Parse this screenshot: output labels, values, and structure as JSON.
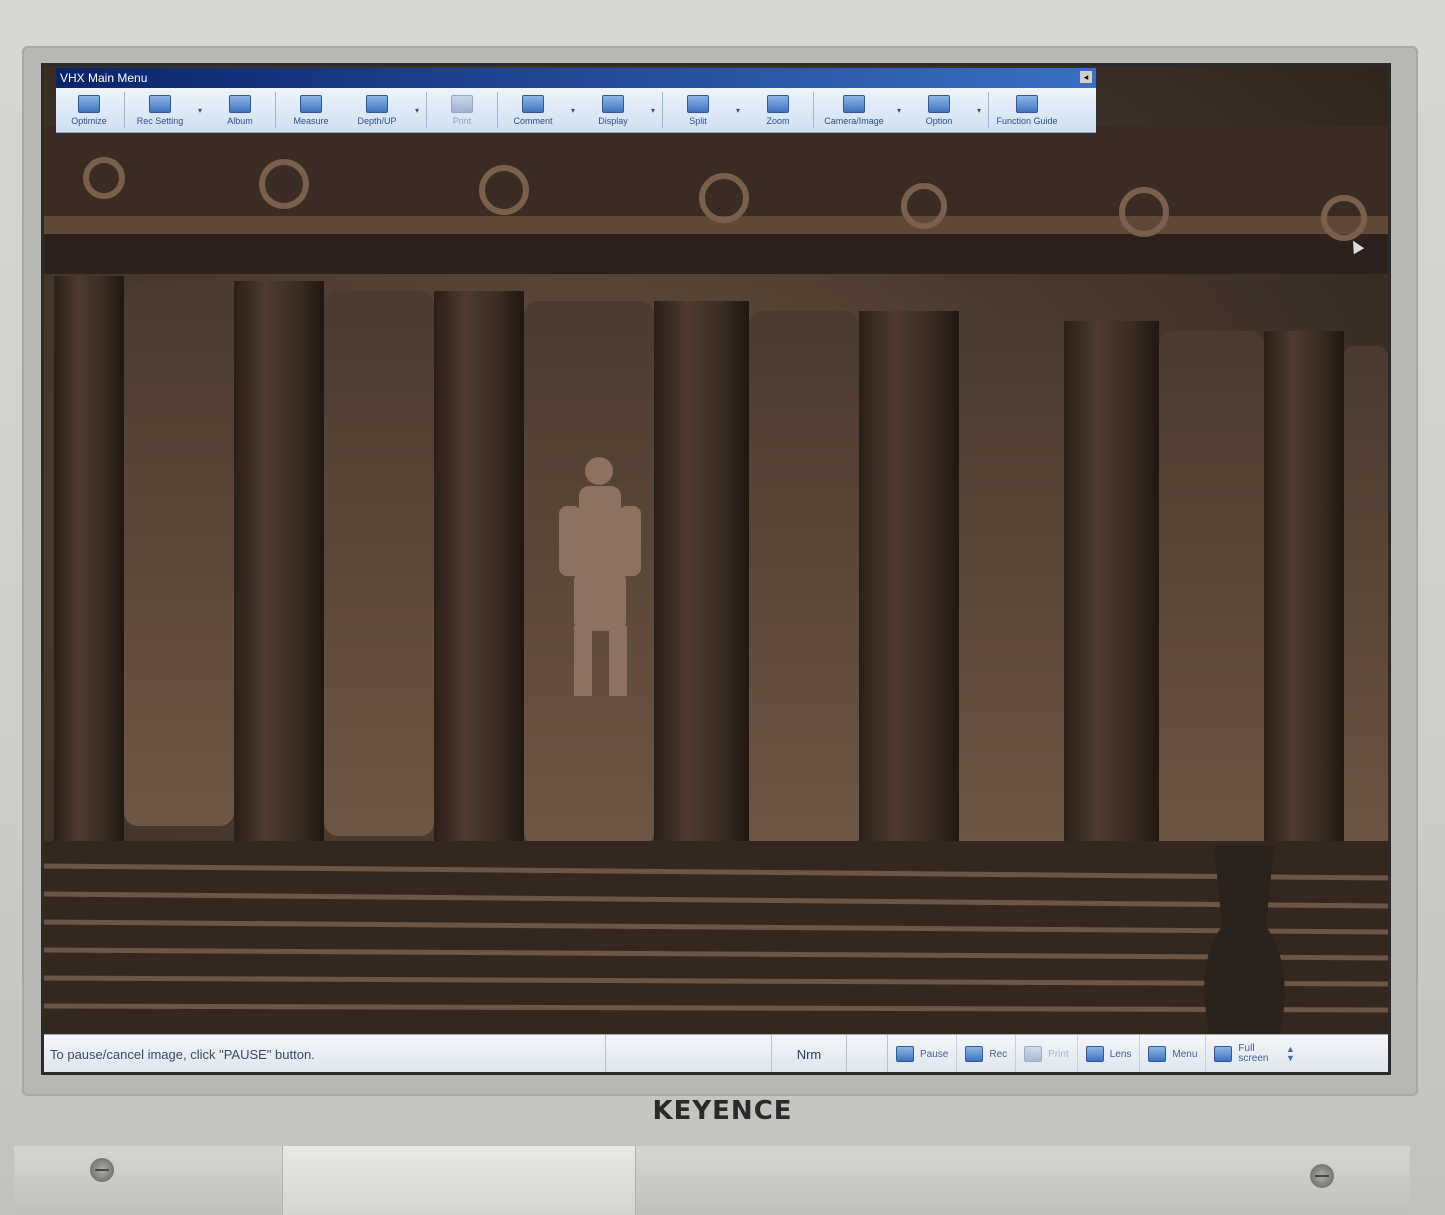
{
  "window": {
    "title": "VHX Main Menu",
    "close_glyph": "◂"
  },
  "toolbar": {
    "items": [
      {
        "label": "Optimize",
        "icon": "optimize-icon"
      },
      {
        "label": "Rec Setting",
        "icon": "rec-setting-icon",
        "dropdown": true
      },
      {
        "label": "Album",
        "icon": "folder-icon"
      },
      {
        "label": "Measure",
        "icon": "measure-icon"
      },
      {
        "label": "Depth/UP",
        "icon": "depth-up-icon",
        "dropdown": true
      },
      {
        "label": "Print",
        "icon": "printer-icon",
        "disabled": true
      },
      {
        "label": "Comment",
        "icon": "comment-icon",
        "dropdown": true
      },
      {
        "label": "Display",
        "icon": "display-icon",
        "dropdown": true
      },
      {
        "label": "Split",
        "icon": "split-icon",
        "dropdown": true
      },
      {
        "label": "Zoom",
        "icon": "zoom-icon"
      },
      {
        "label": "Camera/Image",
        "icon": "camera-image-icon",
        "dropdown": true
      },
      {
        "label": "Option",
        "icon": "option-icon",
        "dropdown": true
      },
      {
        "label": "Function Guide",
        "icon": "help-icon"
      }
    ],
    "dropdown_glyph": "▾"
  },
  "status": {
    "message": "To pause/cancel image, click \"PAUSE\" button.",
    "mode": "Nrm",
    "buttons": [
      {
        "label": "Pause",
        "icon": "pause-icon"
      },
      {
        "label": "Rec",
        "icon": "record-icon"
      },
      {
        "label": "Print",
        "icon": "printer-icon",
        "disabled": true
      },
      {
        "label": "Lens",
        "icon": "lens-icon"
      },
      {
        "label": "Menu",
        "icon": "home-icon"
      },
      {
        "label": "Full screen",
        "icon": "full-screen-icon"
      }
    ],
    "scroll_up": "▲",
    "scroll_down": "▼"
  },
  "monitor": {
    "brand": "KEYENCE"
  },
  "colors": {
    "titlebar": "#0a246a",
    "toolbar_text": "#2f4f86",
    "image_tone": "#4a3a2e"
  }
}
